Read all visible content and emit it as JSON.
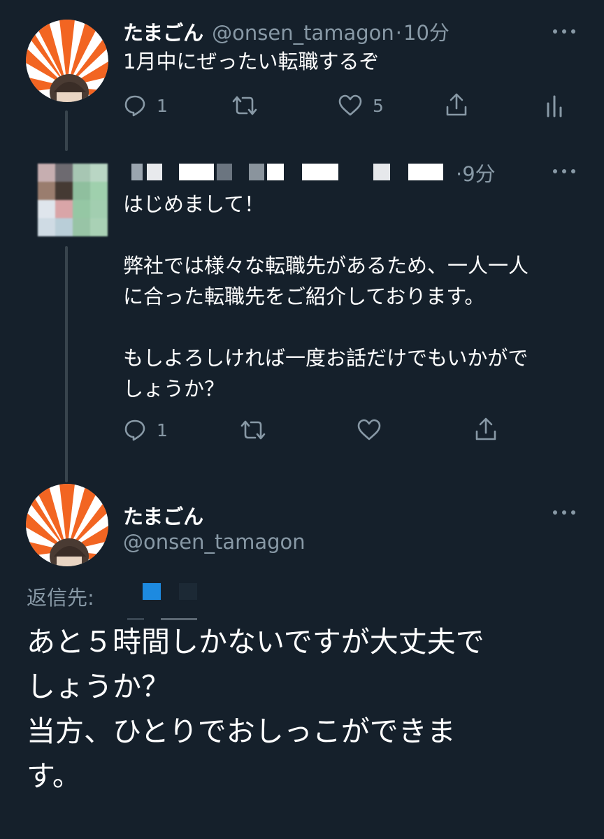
{
  "tweet1": {
    "name": "たまごん",
    "handle": "@onsen_tamagon",
    "separator": "·",
    "time": "10分",
    "text": "1月中にぜったい転職するぞ",
    "reply_count": "1",
    "like_count": "5"
  },
  "tweet2": {
    "time": "·9分",
    "text": "はじめまして！\n\n弊社では様々な転職先があるため、一人一人\nに合った転職先をご紹介しております。\n\nもしよろしければ一度お話だけでもいかがで\nしょうか？",
    "reply_count": "1"
  },
  "tweet3": {
    "name": "たまごん",
    "handle": "@onsen_tamagon",
    "reply_to_label": "返信先:",
    "text": "あと５時間しかないですが大丈夫で\nしょうか？\n当方、ひとりでおしっこができま\nす。"
  },
  "colors": {
    "background": "#15202b",
    "secondary_text": "#8899a6",
    "accent": "#1d9bf0",
    "avatar_orange": "#f26522"
  },
  "icons": {
    "reply": "speech-bubble-icon",
    "retweet": "retweet-arrows-icon",
    "like": "heart-icon",
    "share": "share-upload-icon",
    "analytics": "bar-chart-icon",
    "more": "ellipsis-icon"
  }
}
